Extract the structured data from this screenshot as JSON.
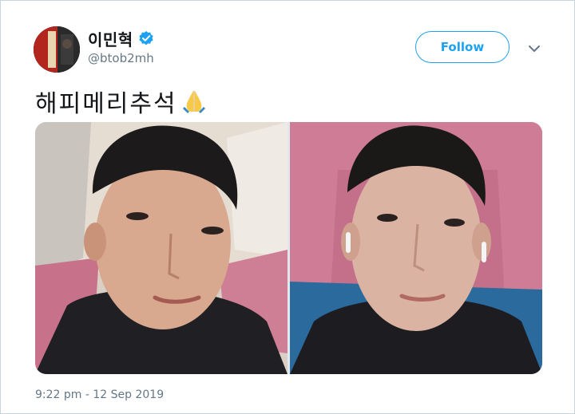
{
  "author": {
    "display_name": "이민혁",
    "handle": "@btob2mh",
    "verified": true,
    "avatar_icon": "profile-avatar"
  },
  "follow_button": {
    "label": "Follow",
    "color": "#1da1f2"
  },
  "menu": {
    "icon": "chevron-down-icon"
  },
  "tweet": {
    "text": "해피메리추석",
    "emoji": "folded-hands-icon",
    "photos": [
      {
        "name": "selfie-photo-left"
      },
      {
        "name": "selfie-photo-right"
      }
    ],
    "timestamp": "9:22 pm - 12 Sep 2019"
  },
  "colors": {
    "text_primary": "#14171a",
    "text_secondary": "#657786",
    "accent": "#1da1f2",
    "border": "#c9d3da"
  }
}
